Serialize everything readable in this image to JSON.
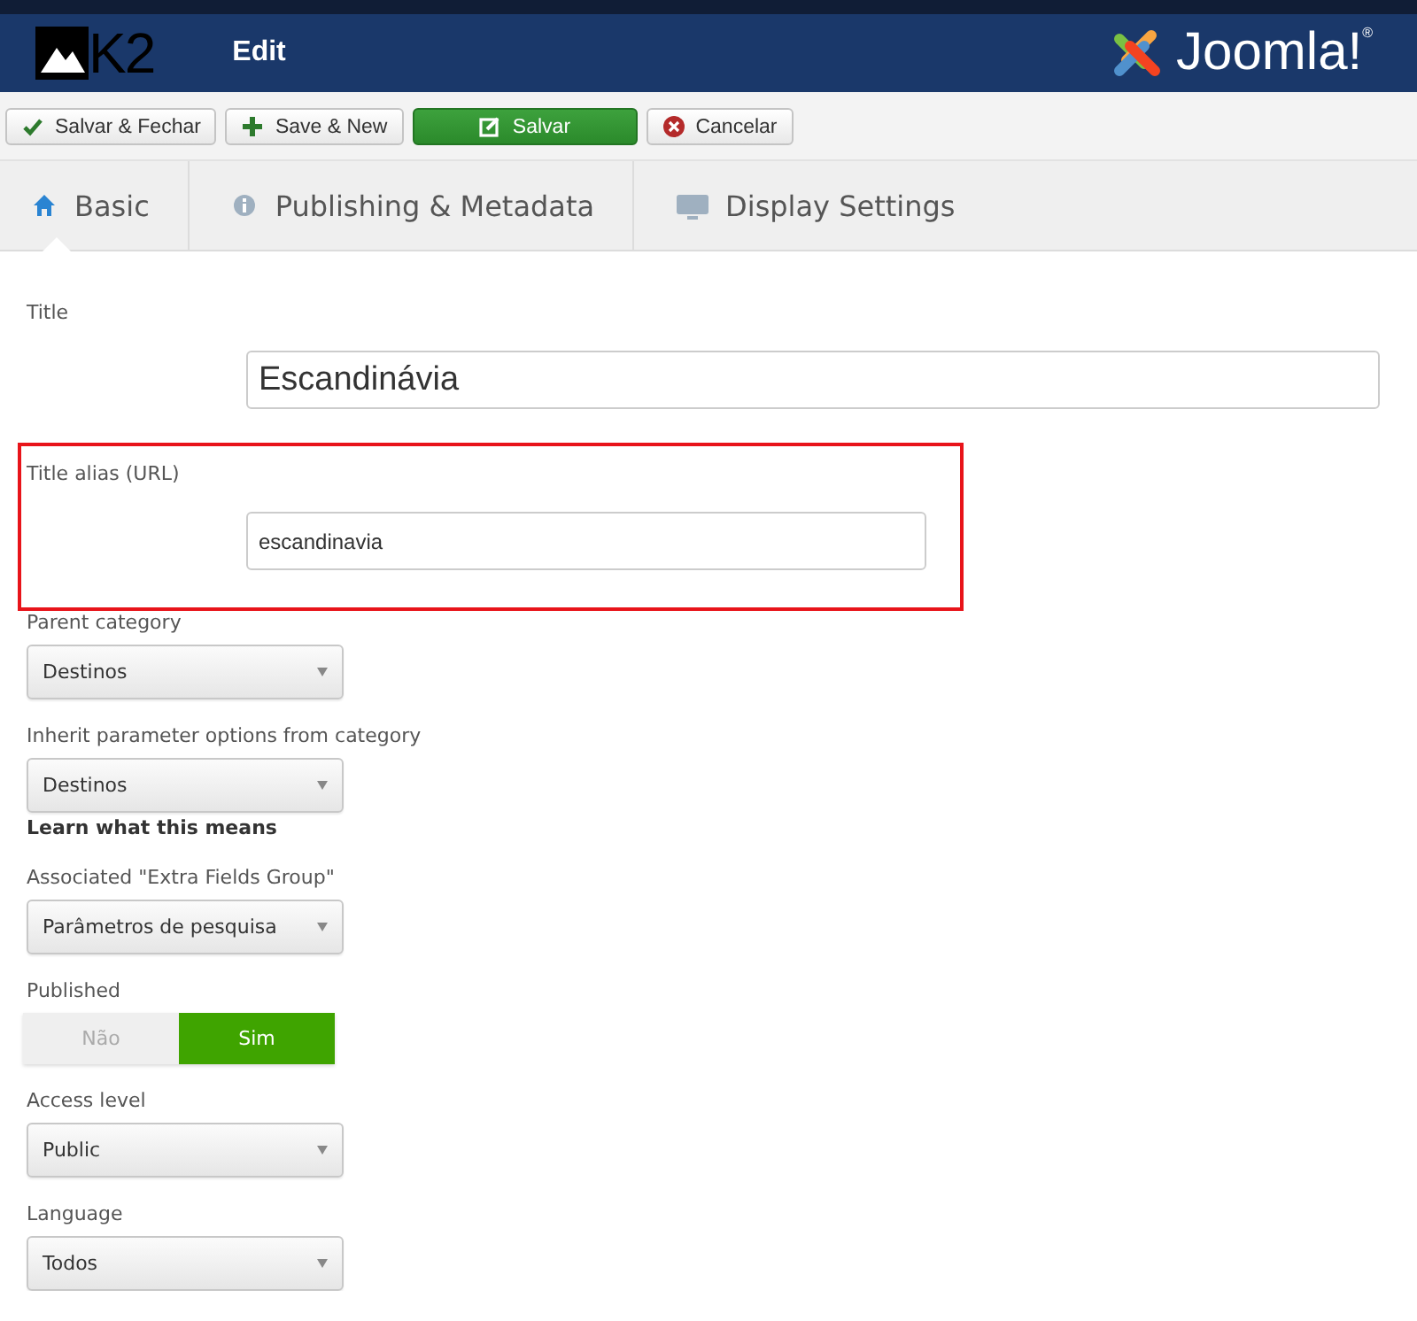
{
  "header": {
    "logo_text": "K2",
    "title": "Edit",
    "brand": "Joomla!$^{®}$"
  },
  "toolbar": [
    {
      "label": "Salvar & Fechar",
      "kind": "default"
    },
    {
      "label": "Save & New",
      "kind": "default"
    },
    {
      "label": "Salvar",
      "kind": "primary"
    },
    {
      "label": "Cancelar",
      "kind": "default"
    }
  ],
  "tabs": [
    {
      "label": "Basic",
      "selected": true
    },
    {
      "label": "Publishing & Metadata",
      "selected": false
    },
    {
      "label": "Display Settings",
      "selected": false
    }
  ],
  "fields": [
    {
      "kind": "text",
      "label": "Title",
      "value": "Escandinávia",
      "highlighted": false
    },
    {
      "kind": "text",
      "label": "Title alias (URL)",
      "value": "escandinavia",
      "highlighted": true
    },
    {
      "kind": "select",
      "label": "Parent category",
      "value": "Destinos"
    },
    {
      "kind": "select",
      "label": "Inherit parameter options from category",
      "value": "Destinos"
    },
    {
      "kind": "link",
      "label": "Learn what this means"
    },
    {
      "kind": "select",
      "label": "Associated \"Extra Fields Group\"",
      "value": "Parâmetros de pesquisa"
    },
    {
      "kind": "toggle",
      "label": "Published",
      "options": [
        {
          "label": "Não",
          "selected": false
        },
        {
          "label": "Sim",
          "selected": true
        }
      ]
    },
    {
      "kind": "select",
      "label": "Access level",
      "value": "Public"
    },
    {
      "kind": "select",
      "label": "Language",
      "value": "Todos"
    }
  ]
}
